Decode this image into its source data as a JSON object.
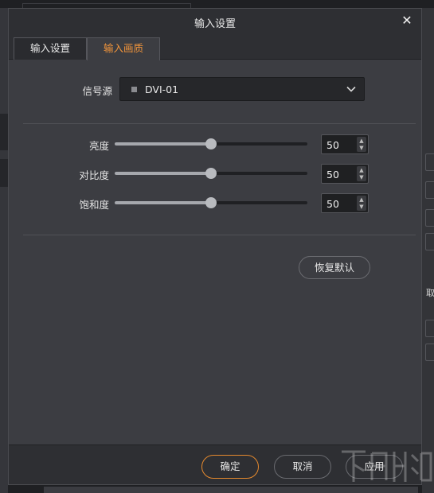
{
  "dialog": {
    "title": "输入设置",
    "close_glyph": "✕"
  },
  "tabs": [
    {
      "label": "输入设置",
      "active": false
    },
    {
      "label": "输入画质",
      "active": true
    }
  ],
  "source": {
    "label": "信号源",
    "value": "DVI-01",
    "chevron_icon": "chevron-down-icon"
  },
  "adjustments": [
    {
      "label": "亮度",
      "value": "50",
      "level": 0.5
    },
    {
      "label": "对比度",
      "value": "50",
      "level": 0.5
    },
    {
      "label": "饱和度",
      "value": "50",
      "level": 0.5
    }
  ],
  "reset_label": "恢复默认",
  "footer": {
    "ok_label": "确定",
    "cancel_label": "取消",
    "apply_label": "应用"
  },
  "background": {
    "right_edge_text": "取"
  },
  "colors": {
    "accent": "#f0943b",
    "dialog_bg": "#3c3d42",
    "titlebar_bg": "#2e2f33"
  }
}
